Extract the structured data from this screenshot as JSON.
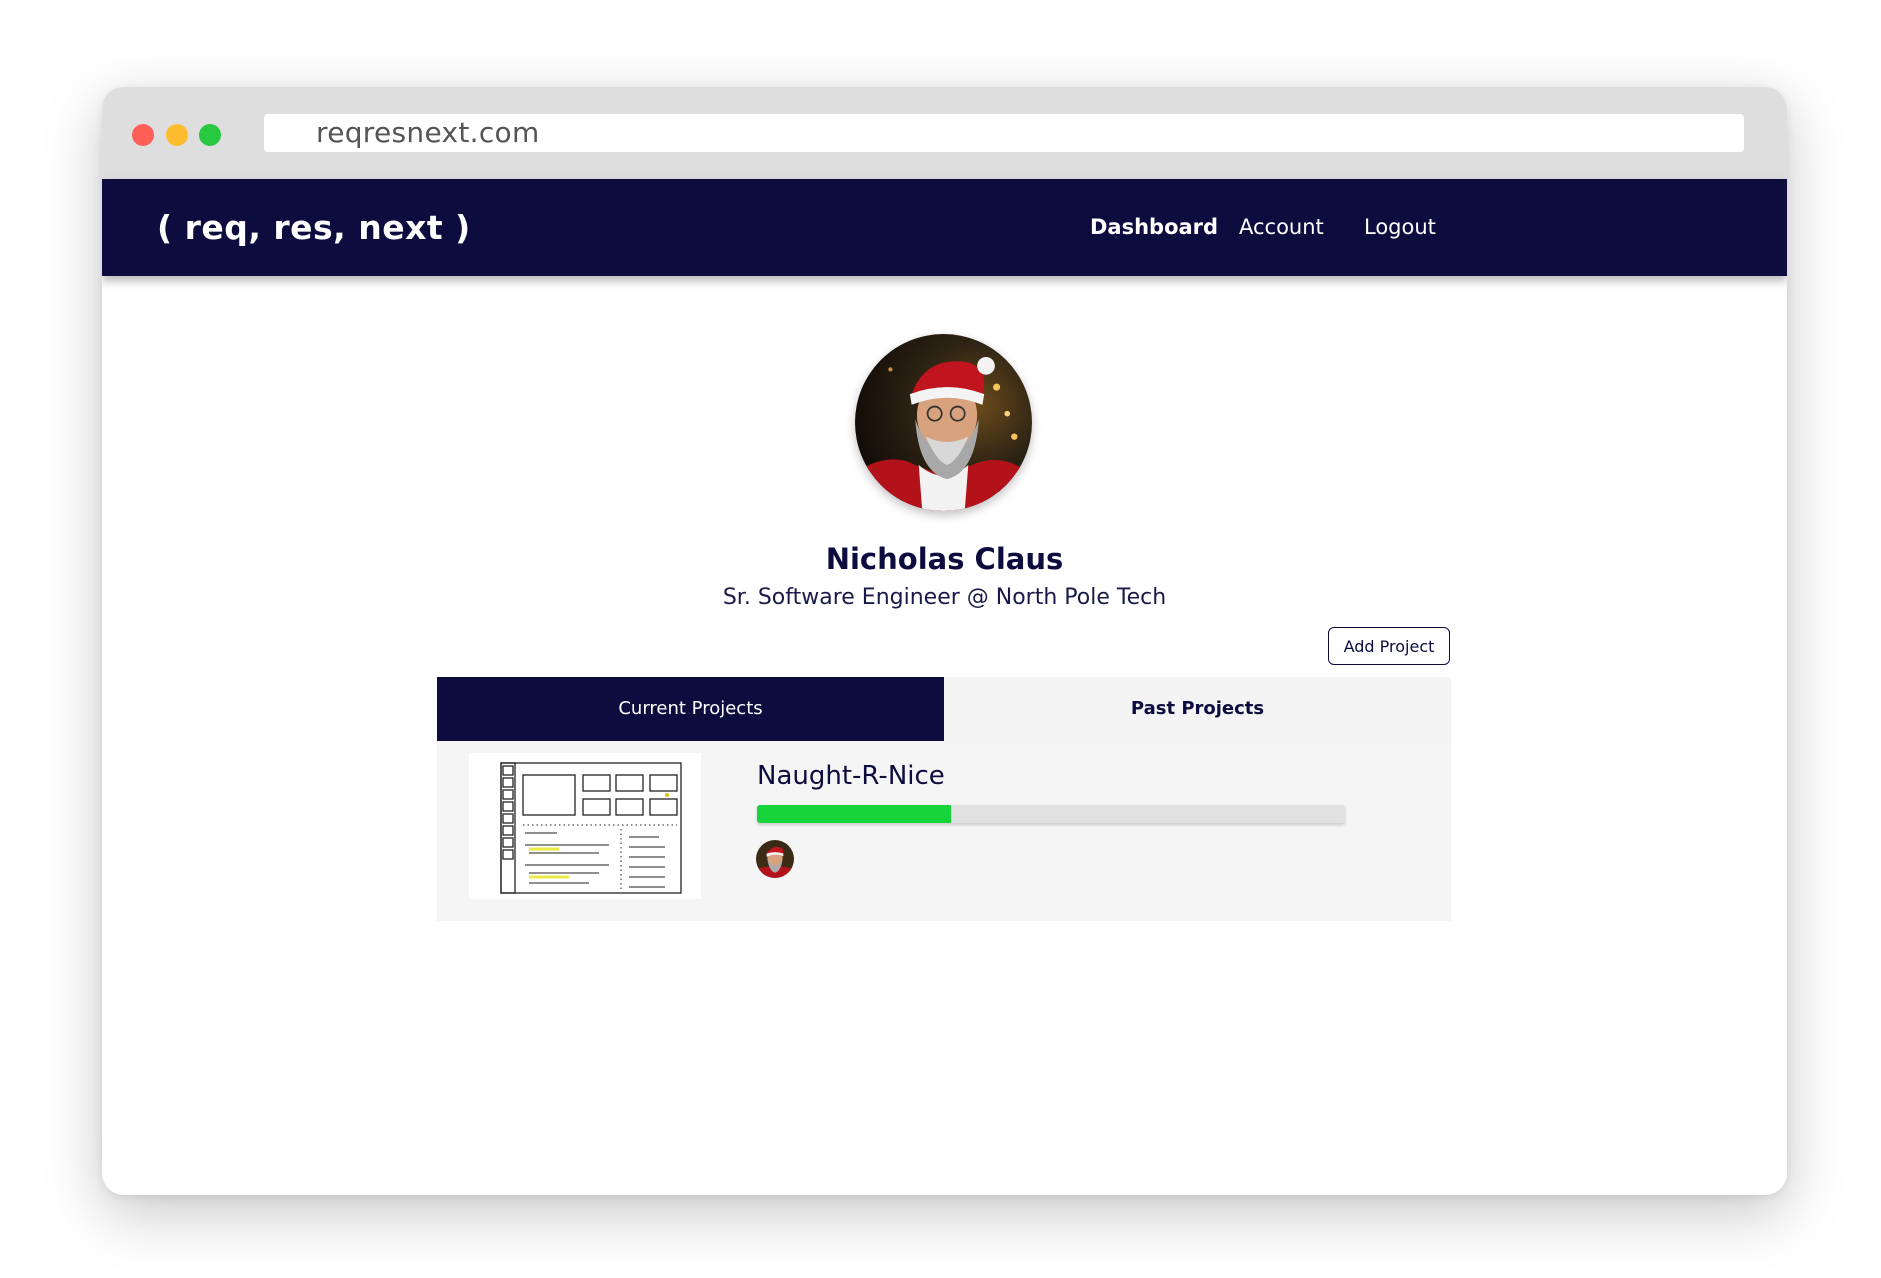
{
  "browser": {
    "url": "reqresnext.com",
    "dot_colors": {
      "close": "#fe5f57",
      "minimize": "#febc2e",
      "maximize": "#28c840"
    }
  },
  "navbar": {
    "brand": "( req, res, next )",
    "links": [
      {
        "label": "Dashboard",
        "active": true
      },
      {
        "label": "Account",
        "active": false
      },
      {
        "label": "Logout",
        "active": false
      }
    ],
    "background": "#0c0c3f"
  },
  "profile": {
    "name": "Nicholas Claus",
    "title": "Sr. Software Engineer @ North Pole Tech",
    "avatar_icon": "user-avatar-photo"
  },
  "actions": {
    "add_project_label": "Add Project"
  },
  "tabs": [
    {
      "label": "Current Projects",
      "active": true
    },
    {
      "label": "Past Projects",
      "active": false
    }
  ],
  "projects": [
    {
      "name": "Naught-R-Nice",
      "progress_percent": 33,
      "progress_color": "#17d43a",
      "thumbnail_icon": "wireframe-sketch-thumbnail",
      "member_icon": "member-avatar-photo"
    }
  ]
}
